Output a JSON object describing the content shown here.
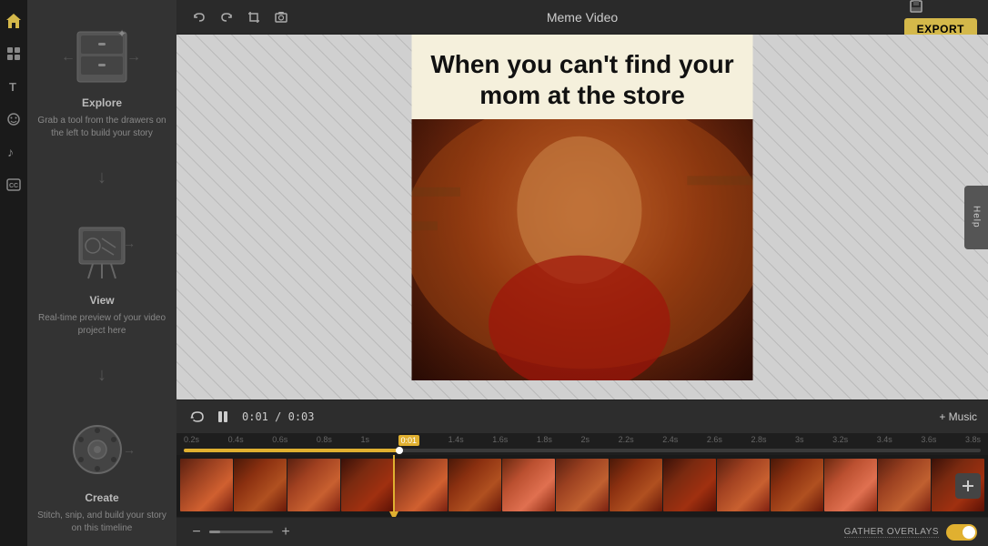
{
  "app": {
    "title": "Meme Video"
  },
  "toolbar": {
    "undo_label": "↩",
    "redo_label": "↪",
    "export_label": "EXPORT"
  },
  "meme": {
    "text": "When you can't find your mom at the store"
  },
  "playback": {
    "current_time": "0:01",
    "total_time": "0:03",
    "separator": "/"
  },
  "music_btn": {
    "label": "+ Music"
  },
  "timeline": {
    "labels": [
      "0.2s",
      "0.4s",
      "0.6s",
      "0.8s",
      "1s",
      "0:01",
      "1.4s",
      "1.6s",
      "1.8s",
      "2s",
      "2.2s",
      "2.4s",
      "2.6s",
      "2.8s",
      "3s",
      "3.2s",
      "3.4s",
      "3.6s",
      "3.8s"
    ]
  },
  "footer": {
    "gather_overlays_label": "GATHER OVERLAYS",
    "help_label": "Help"
  },
  "onboarding": {
    "explore": {
      "title": "Explore",
      "desc": "Grab a tool from the drawers on the left to build your story"
    },
    "view": {
      "title": "View",
      "desc": "Real-time preview of your video project here"
    },
    "create": {
      "title": "Create",
      "desc": "Stitch, snip, and build your story on this timeline"
    }
  },
  "sidebar": {
    "icons": [
      "▶",
      "⊞",
      "T",
      "☁",
      "♪",
      "CC"
    ]
  }
}
